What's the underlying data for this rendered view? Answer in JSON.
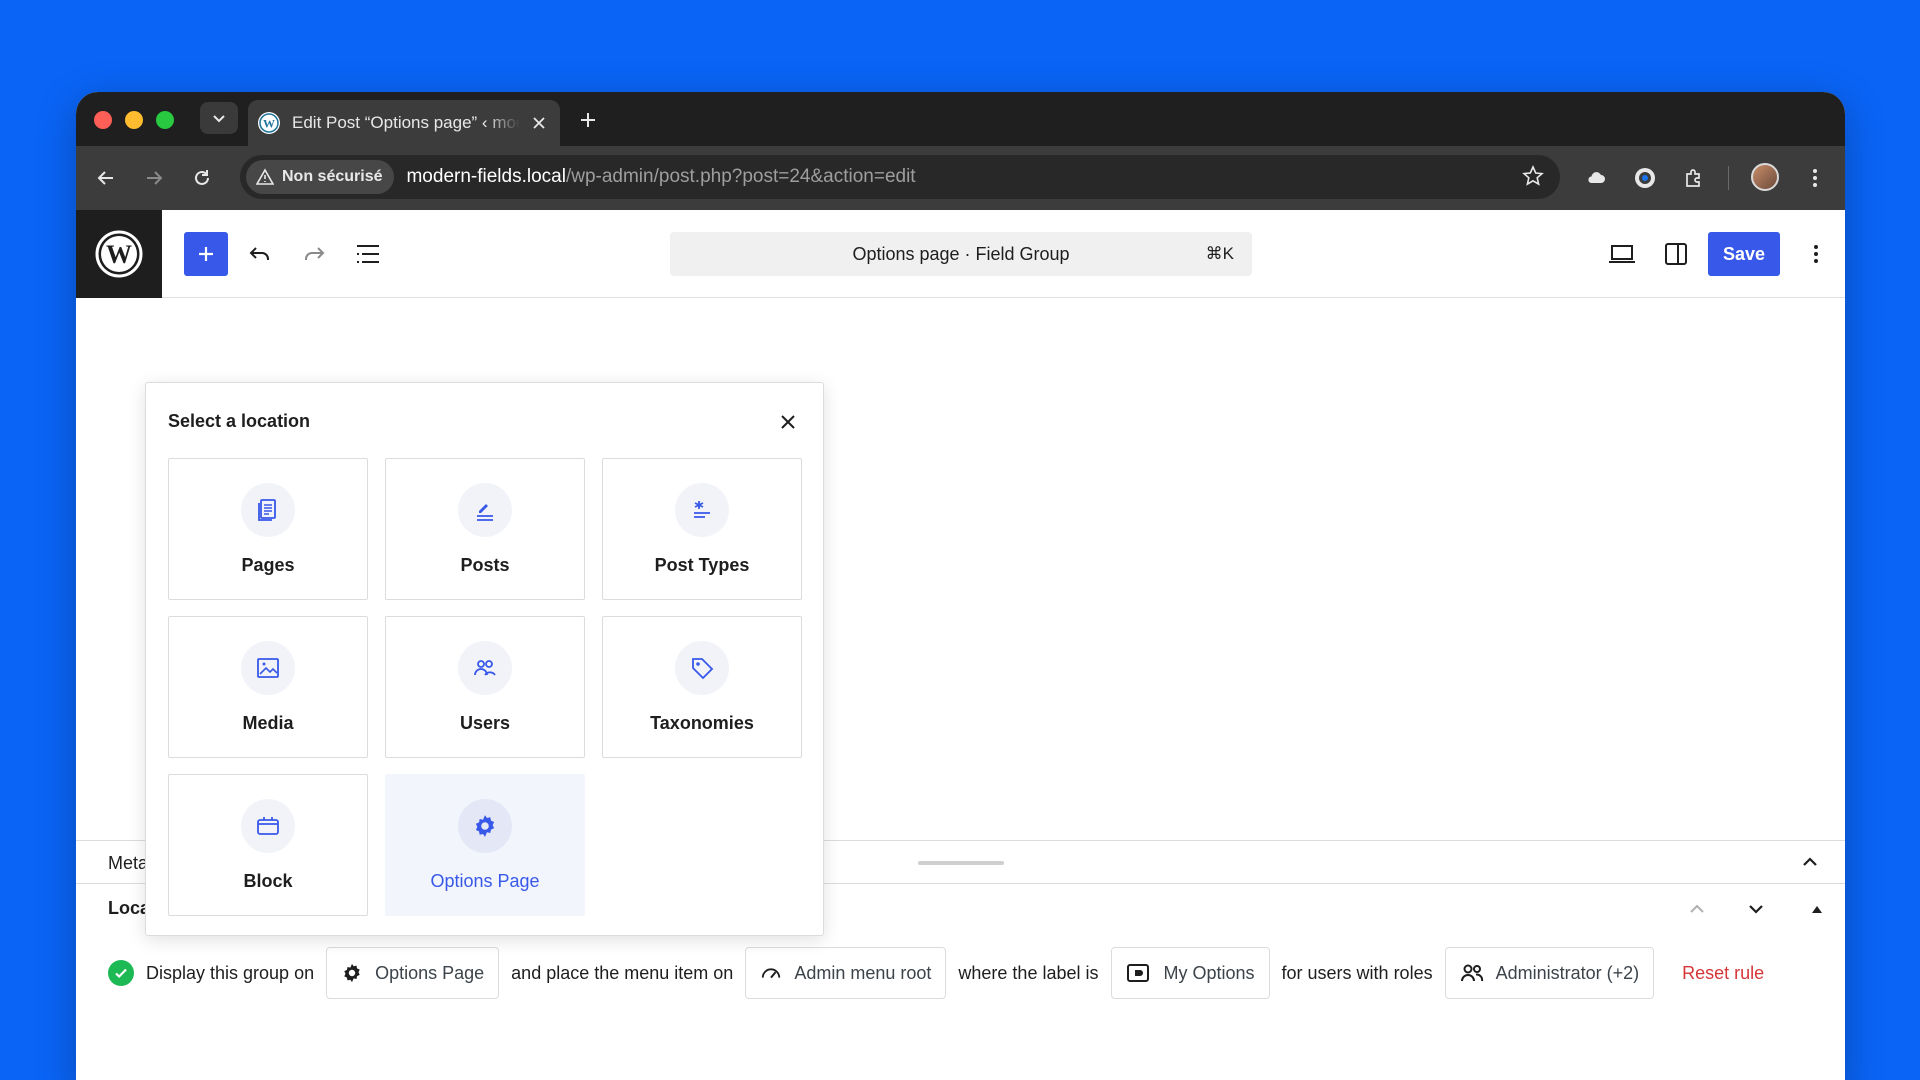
{
  "browser": {
    "tab_title": "Edit Post “Options page” ‹ modern-fields",
    "security_chip": "Non sécurisé",
    "url_host": "modern-fields.local",
    "url_path": "/wp-admin/post.php?post=24&action=edit"
  },
  "editor": {
    "command_bar": "Options page · Field Group",
    "command_shortcut": "⌘K",
    "save_label": "Save"
  },
  "popover": {
    "title": "Select a location",
    "options": [
      {
        "label": "Pages",
        "icon": "pages-icon"
      },
      {
        "label": "Posts",
        "icon": "posts-icon"
      },
      {
        "label": "Post Types",
        "icon": "post-types-icon"
      },
      {
        "label": "Media",
        "icon": "media-icon"
      },
      {
        "label": "Users",
        "icon": "users-icon"
      },
      {
        "label": "Taxonomies",
        "icon": "tag-icon"
      },
      {
        "label": "Block",
        "icon": "block-icon"
      },
      {
        "label": "Options Page",
        "icon": "gear-icon",
        "selected": true
      }
    ]
  },
  "meta": {
    "panel_label": "Meta",
    "location_label": "Loca"
  },
  "rule": {
    "prefix": "Display this group on",
    "location_value": "Options Page",
    "menu_text": "and place the menu item on",
    "menu_value": "Admin menu root",
    "label_text": "where the label is",
    "label_value": "My Options",
    "roles_text": "for users with roles",
    "roles_value": "Administrator (+2)",
    "reset_label": "Reset rule"
  },
  "colors": {
    "accent": "#3858e9",
    "desktop_bg": "#0a64f5",
    "success": "#1db954",
    "danger": "#d63638"
  }
}
